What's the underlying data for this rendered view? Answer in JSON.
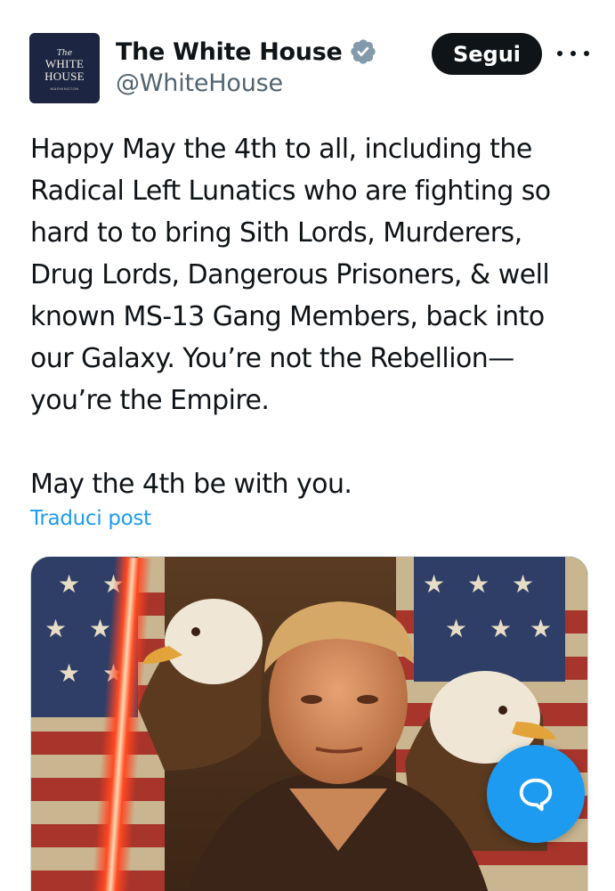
{
  "account": {
    "avatar_text": {
      "the": "The",
      "line1": "WHITE",
      "line2": "HOUSE",
      "small": "WASHINGTON"
    },
    "display_name": "The White House",
    "handle": "@WhiteHouse",
    "verified_icon": "verified-badge-icon"
  },
  "actions": {
    "follow_label": "Segui",
    "more_icon": "more-options-icon"
  },
  "post": {
    "lines_p1": [
      "Happy May the 4th to all, including the",
      "Radical Left Lunatics who are fighting so",
      "hard to to bring Sith Lords, Murderers,",
      "Drug Lords, Dangerous Prisoners, & well",
      "known MS-13 Gang Members, back into",
      "our Galaxy. You’re not the Rebellion—",
      "you’re the Empire."
    ],
    "lines_p2": [
      "May the 4th be with you."
    ],
    "translate_label": "Traduci post"
  },
  "media": {
    "icon": "post-image"
  },
  "compose": {
    "icon": "chat-bubble-icon"
  },
  "colors": {
    "text": "#0f1419",
    "secondary": "#536471",
    "accent": "#1d9bf0",
    "button_bg": "#0f1419"
  }
}
